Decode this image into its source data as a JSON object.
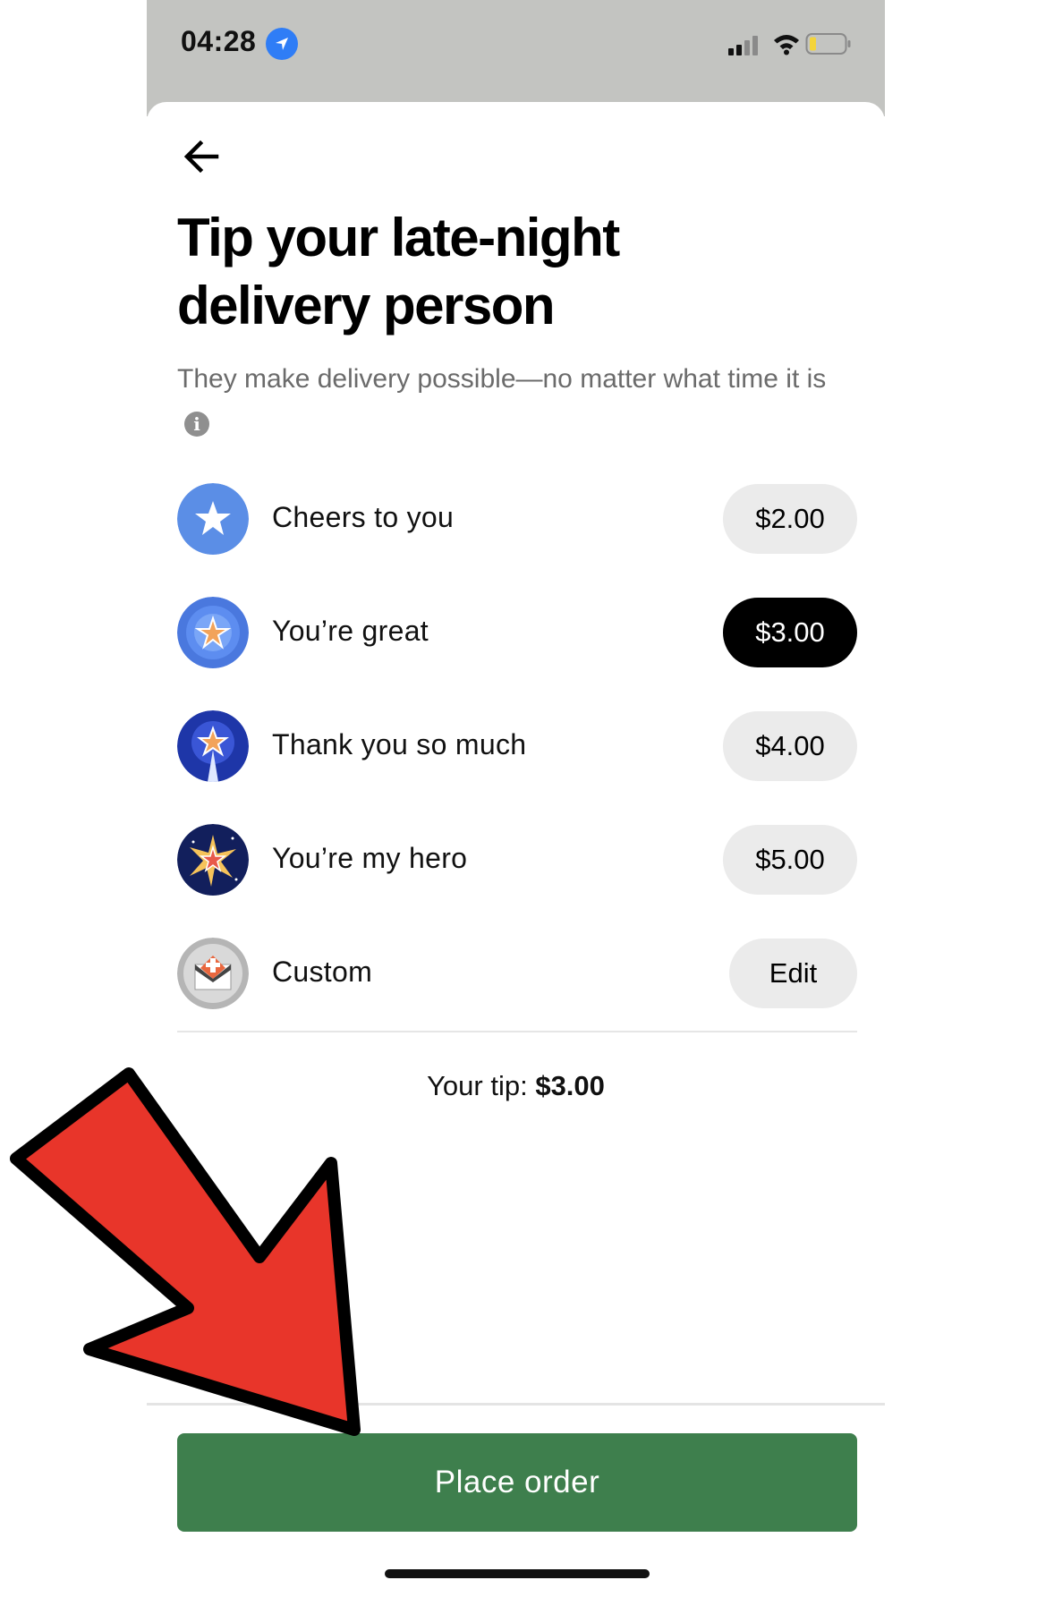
{
  "status_bar": {
    "time": "04:28",
    "icons": [
      "location-arrow-icon",
      "signal-icon",
      "wifi-icon",
      "battery-low-icon"
    ]
  },
  "header": {
    "back_icon": "arrow-left-icon",
    "title": "Tip your late-night delivery person",
    "subtitle": "They make delivery possible—no matter what time it is",
    "info_icon": "info-icon"
  },
  "tip_options": [
    {
      "label": "Cheers to you",
      "amount": "$2.00",
      "selected": false,
      "icon": "star-badge-icon"
    },
    {
      "label": "You’re great",
      "amount": "$3.00",
      "selected": true,
      "icon": "gold-star-badge-icon"
    },
    {
      "label": "Thank you so much",
      "amount": "$4.00",
      "selected": false,
      "icon": "rocket-star-badge-icon"
    },
    {
      "label": "You’re my hero",
      "amount": "$5.00",
      "selected": false,
      "icon": "burst-star-badge-icon"
    },
    {
      "label": "Custom",
      "amount": "Edit",
      "selected": false,
      "icon": "envelope-badge-icon"
    }
  ],
  "summary": {
    "label": "Your tip:",
    "value": "$3.00"
  },
  "footer": {
    "button_label": "Place order"
  },
  "colors": {
    "status_bar_bg": "#c3c4c1",
    "selected_pill": "#000000",
    "pill": "#ebebeb",
    "place_order": "#3e7f4d",
    "annotation_arrow": "#e8352a"
  },
  "annotation": {
    "icon": "red-arrow-annotation"
  }
}
